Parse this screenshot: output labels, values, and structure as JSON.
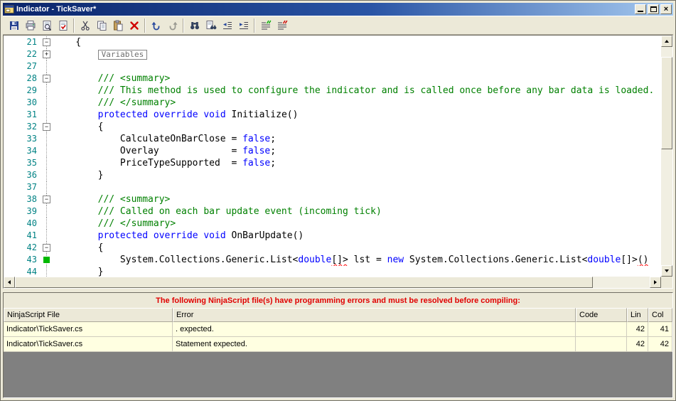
{
  "window": {
    "title": "Indicator - TickSaver*",
    "buttons": [
      "minimize",
      "maximize",
      "close"
    ]
  },
  "colors": {
    "titlebar_left": "#0a246a",
    "titlebar_right": "#a6caf0",
    "keyword": "#0000ff",
    "comment": "#008000",
    "line_number": "#008284",
    "error_text": "#e00000",
    "error_row_bg": "#ffffe1",
    "panel_empty_bg": "#808080"
  },
  "toolbar": {
    "groups": [
      [
        "save-icon",
        "print-icon",
        "print-preview-icon",
        "validate-icon"
      ],
      [
        "cut-icon",
        "copy-icon",
        "paste-icon",
        "delete-icon"
      ],
      [
        "undo-icon",
        "redo-icon"
      ],
      [
        "find-icon",
        "replace-icon",
        "indent-decrease-icon",
        "indent-increase-icon"
      ],
      [
        "comment-icon",
        "uncomment-icon"
      ]
    ]
  },
  "editor": {
    "collapsed_region_label": "Variables",
    "lines": [
      {
        "n": "21",
        "f": "minus",
        "s": [
          [
            "p",
            "    {"
          ]
        ]
      },
      {
        "n": "22",
        "f": "plus",
        "s": [
          [
            "p",
            "        "
          ],
          [
            "r",
            "Variables"
          ]
        ]
      },
      {
        "n": "27",
        "f": "line",
        "s": []
      },
      {
        "n": "28",
        "f": "minus",
        "s": [
          [
            "c",
            "        /// <summary>"
          ]
        ]
      },
      {
        "n": "29",
        "f": "line",
        "s": [
          [
            "c",
            "        /// This method is used to configure the indicator and is called once before any bar data is loaded."
          ]
        ]
      },
      {
        "n": "30",
        "f": "line",
        "s": [
          [
            "c",
            "        /// </summary>"
          ]
        ]
      },
      {
        "n": "31",
        "f": "line",
        "s": [
          [
            "p",
            "        "
          ],
          [
            "k",
            "protected"
          ],
          [
            "p",
            " "
          ],
          [
            "k",
            "override"
          ],
          [
            "p",
            " "
          ],
          [
            "k",
            "void"
          ],
          [
            "p",
            " Initialize()"
          ]
        ]
      },
      {
        "n": "32",
        "f": "minus",
        "s": [
          [
            "p",
            "        {"
          ]
        ]
      },
      {
        "n": "33",
        "f": "line",
        "s": [
          [
            "p",
            "            CalculateOnBarClose = "
          ],
          [
            "k",
            "false"
          ],
          [
            "p",
            ";"
          ]
        ]
      },
      {
        "n": "34",
        "f": "line",
        "s": [
          [
            "p",
            "            Overlay             = "
          ],
          [
            "k",
            "false"
          ],
          [
            "p",
            ";"
          ]
        ]
      },
      {
        "n": "35",
        "f": "line",
        "s": [
          [
            "p",
            "            PriceTypeSupported  = "
          ],
          [
            "k",
            "false"
          ],
          [
            "p",
            ";"
          ]
        ]
      },
      {
        "n": "36",
        "f": "line",
        "s": [
          [
            "p",
            "        }"
          ]
        ]
      },
      {
        "n": "37",
        "f": "line",
        "s": []
      },
      {
        "n": "38",
        "f": "minus",
        "s": [
          [
            "c",
            "        /// <summary>"
          ]
        ]
      },
      {
        "n": "39",
        "f": "line",
        "s": [
          [
            "c",
            "        /// Called on each bar update event (incoming tick)"
          ]
        ]
      },
      {
        "n": "40",
        "f": "line",
        "s": [
          [
            "c",
            "        /// </summary>"
          ]
        ]
      },
      {
        "n": "41",
        "f": "line",
        "s": [
          [
            "p",
            "        "
          ],
          [
            "k",
            "protected"
          ],
          [
            "p",
            " "
          ],
          [
            "k",
            "override"
          ],
          [
            "p",
            " "
          ],
          [
            "k",
            "void"
          ],
          [
            "p",
            " OnBarUpdate()"
          ]
        ]
      },
      {
        "n": "42",
        "f": "minus",
        "s": [
          [
            "p",
            "        {"
          ]
        ]
      },
      {
        "n": "43",
        "f": "green",
        "s": [
          [
            "p",
            "            System.Collections.Generic.List<"
          ],
          [
            "k",
            "double"
          ],
          [
            "e",
            "[]>"
          ],
          [
            "p",
            " lst = "
          ],
          [
            "k",
            "new"
          ],
          [
            "p",
            " System.Collections.Generic.List<"
          ],
          [
            "k",
            "double"
          ],
          [
            "p",
            "[]>"
          ],
          [
            "e",
            "()"
          ]
        ]
      },
      {
        "n": "44",
        "f": "line",
        "s": [
          [
            "p",
            "        }"
          ]
        ]
      }
    ]
  },
  "error_panel": {
    "message": "The following NinjaScript file(s) have programming errors and must be resolved before compiling:",
    "columns": [
      "NinjaScript File",
      "Error",
      "Code",
      "Lin",
      "Col"
    ],
    "rows": [
      {
        "file": "Indicator\\TickSaver.cs",
        "error": ". expected.",
        "code": "",
        "lin": "42",
        "col": "41"
      },
      {
        "file": "Indicator\\TickSaver.cs",
        "error": "Statement expected.",
        "code": "",
        "lin": "42",
        "col": "42"
      }
    ]
  }
}
